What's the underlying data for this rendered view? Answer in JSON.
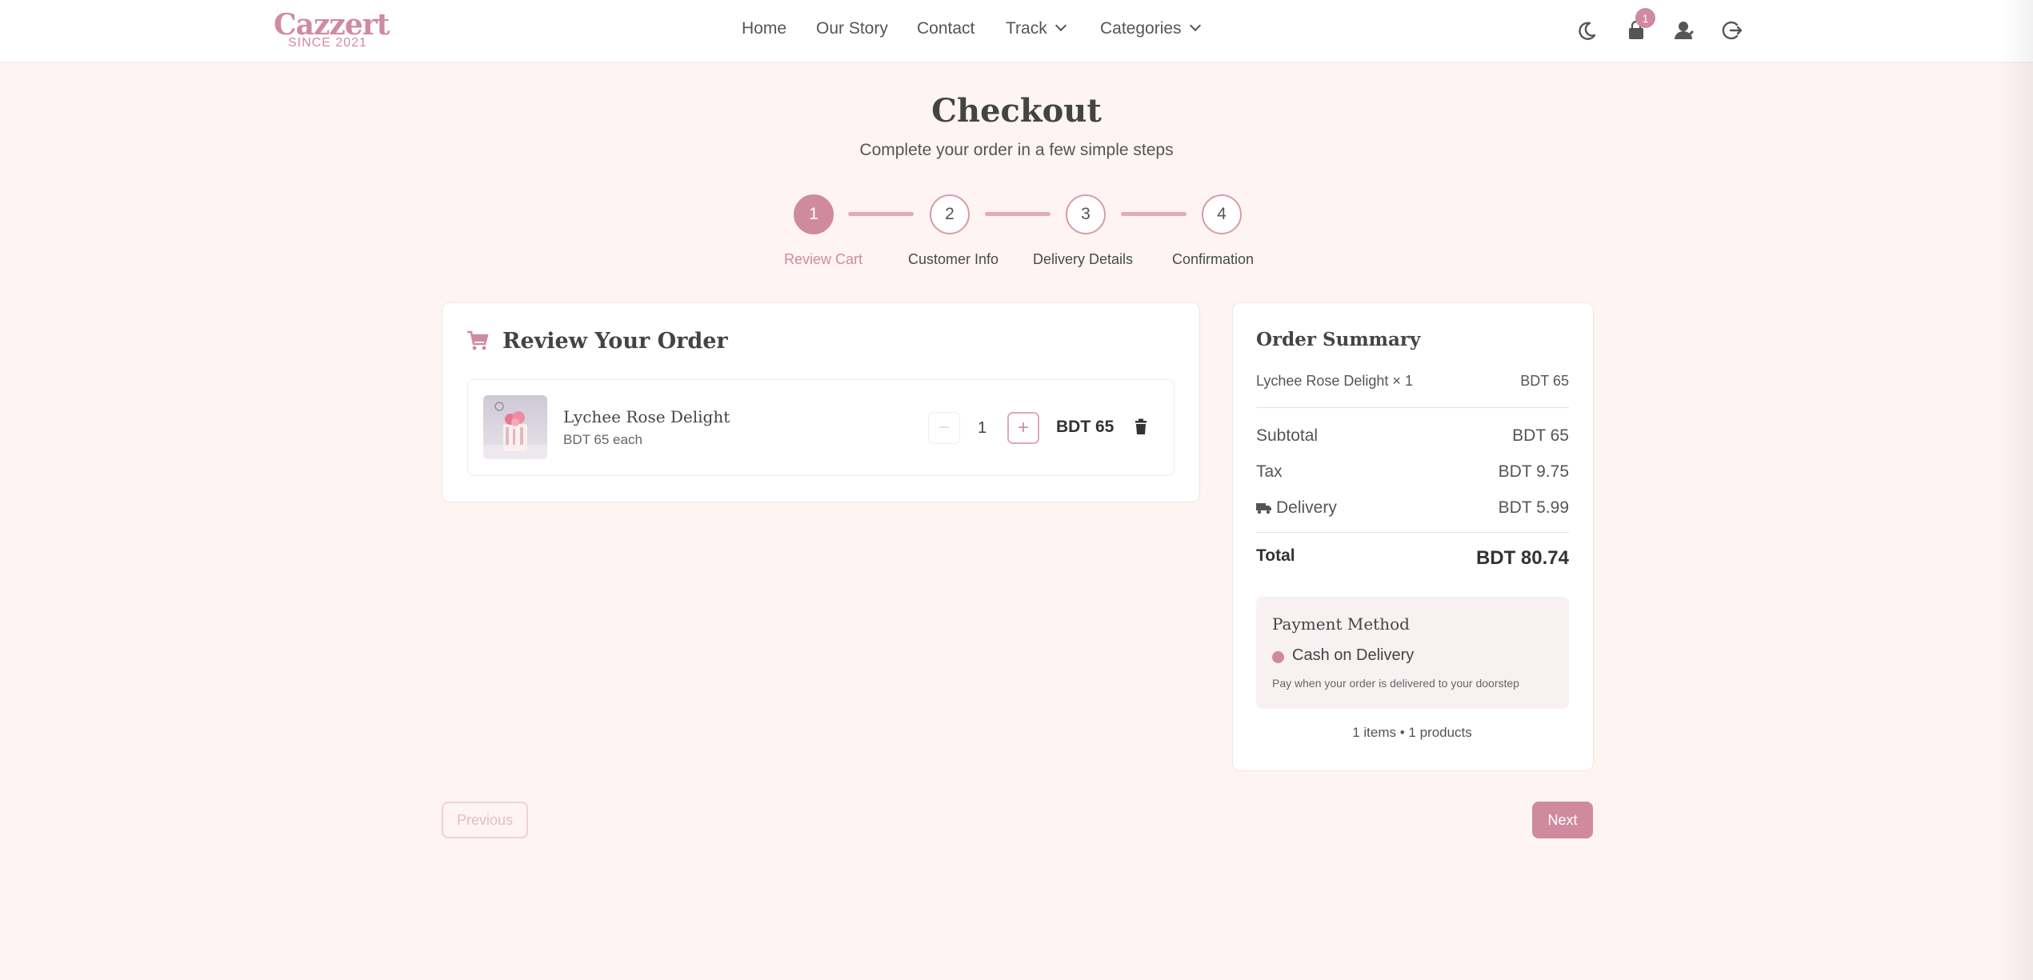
{
  "brand": {
    "name": "Cazzert",
    "since": "SINCE 2021",
    "accent": "#d08aa0"
  },
  "nav": {
    "links": [
      {
        "label": "Home"
      },
      {
        "label": "Our Story"
      },
      {
        "label": "Contact"
      },
      {
        "label": "Track",
        "dropdown": true
      },
      {
        "label": "Categories",
        "dropdown": true
      }
    ],
    "icons": [
      "moon-icon",
      "shopping-bag-icon",
      "user-icon",
      "logout-icon"
    ],
    "cart_count": "1"
  },
  "header": {
    "title": "Checkout",
    "subtitle": "Complete your order in a few simple steps"
  },
  "stepper": {
    "active_step": 1,
    "steps": [
      {
        "number": "1",
        "label": "Review Cart"
      },
      {
        "number": "2",
        "label": "Customer Info"
      },
      {
        "number": "3",
        "label": "Delivery Details"
      },
      {
        "number": "4",
        "label": "Confirmation"
      }
    ]
  },
  "review": {
    "title": "Review Your Order",
    "items": [
      {
        "name": "Lychee Rose Delight",
        "unit_price": "BDT 65 each",
        "quantity": "1",
        "total": "BDT 65",
        "minus_label": "−",
        "plus_label": "+"
      }
    ]
  },
  "summary": {
    "title": "Order Summary",
    "line_items": [
      {
        "label": "Lychee Rose Delight × 1",
        "amount": "BDT 65"
      }
    ],
    "subtotal": {
      "label": "Subtotal",
      "amount": "BDT 65"
    },
    "tax": {
      "label": "Tax",
      "amount": "BDT 9.75"
    },
    "delivery": {
      "label": "Delivery",
      "amount": "BDT 5.99"
    },
    "total": {
      "label": "Total",
      "amount": "BDT 80.74"
    },
    "payment": {
      "title": "Payment Method",
      "option": "Cash on Delivery",
      "description": "Pay when your order is delivered to your doorstep"
    },
    "counts": "1 items • 1 products"
  },
  "actions": {
    "previous": "Previous",
    "next": "Next"
  }
}
